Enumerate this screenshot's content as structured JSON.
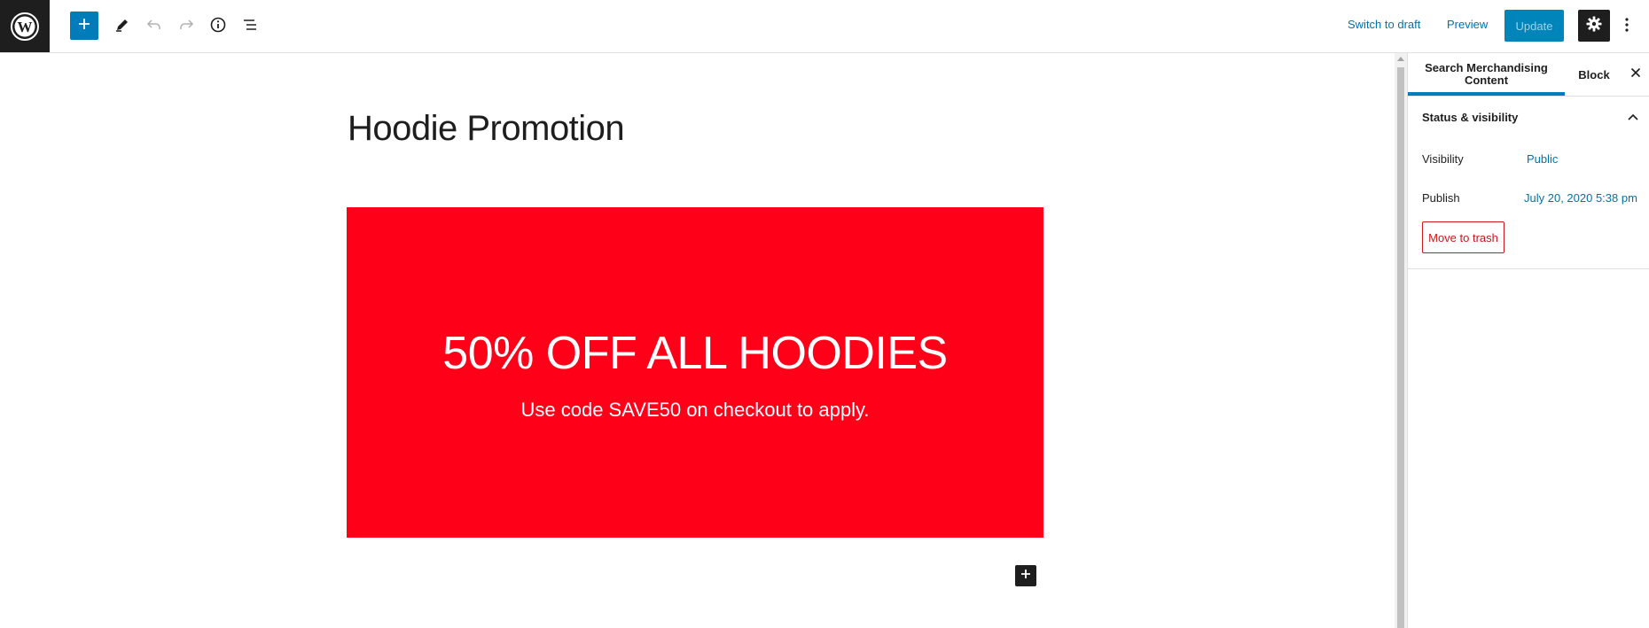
{
  "toolbar": {
    "add_block_icon": "plus-icon",
    "tools_icon": "pencil-icon",
    "undo_icon": "undo-icon",
    "redo_icon": "redo-icon",
    "info_icon": "info-icon",
    "outline_icon": "list-view-icon",
    "switch_to_draft": "Switch to draft",
    "preview": "Preview",
    "update": "Update",
    "settings_icon": "gear-icon",
    "more_icon": "more-vertical-icon",
    "accent_color": "#007cba"
  },
  "editor": {
    "post_title": "Hoodie Promotion",
    "cover": {
      "heading": "50% OFF ALL HOODIES",
      "text": "Use code SAVE50 on checkout to apply.",
      "background_color": "#ff0019"
    }
  },
  "sidebar": {
    "tabs": [
      {
        "label": "Search Merchandising Content",
        "active": true
      },
      {
        "label": "Block",
        "active": false
      }
    ],
    "panel": {
      "title": "Status & visibility",
      "expanded": true,
      "visibility_label": "Visibility",
      "visibility_value": "Public",
      "publish_label": "Publish",
      "publish_value": "July 20, 2020 5:38 pm",
      "trash_label": "Move to trash"
    }
  }
}
